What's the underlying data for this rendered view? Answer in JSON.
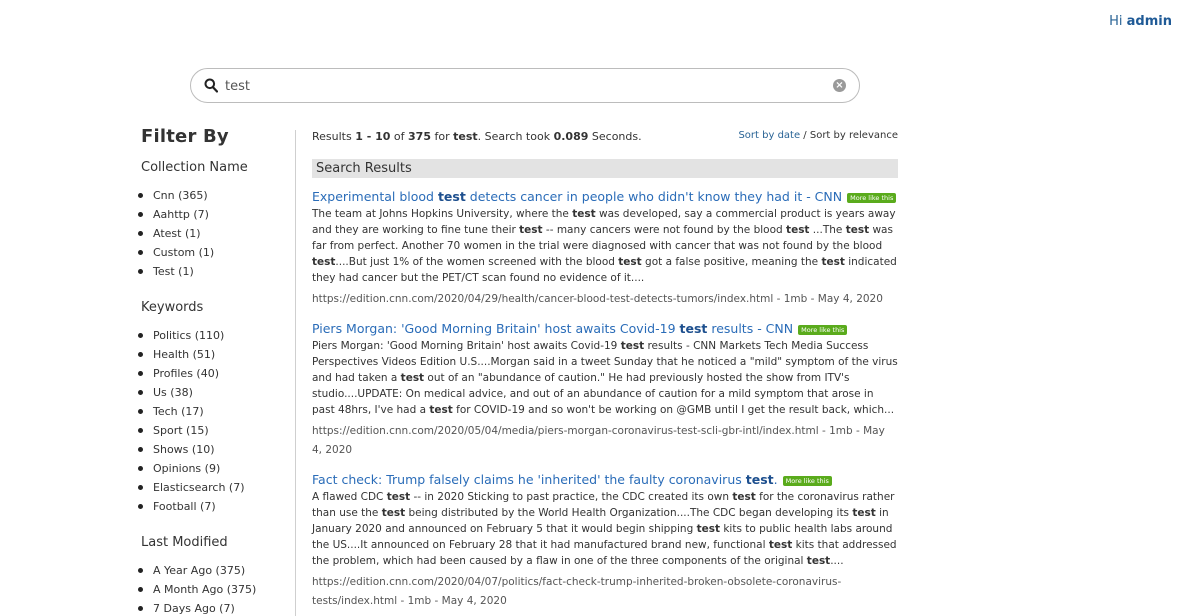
{
  "header": {
    "greeting_prefix": "Hi",
    "user": "admin"
  },
  "search": {
    "query": "test",
    "placeholder": ""
  },
  "sidebar": {
    "title": "Filter By",
    "facets": [
      {
        "title": "Collection Name",
        "items": [
          "Cnn (365)",
          "Aahttp (7)",
          "Atest (1)",
          "Custom (1)",
          "Test (1)"
        ]
      },
      {
        "title": "Keywords",
        "items": [
          "Politics (110)",
          "Health (51)",
          "Profiles (40)",
          "Us (38)",
          "Tech (17)",
          "Sport (15)",
          "Shows (10)",
          "Opinions (9)",
          "Elasticsearch (7)",
          "Football (7)"
        ]
      },
      {
        "title": "Last Modified",
        "items": [
          "A Year Ago (375)",
          "A Month Ago (375)",
          "7 Days Ago (7)"
        ]
      }
    ]
  },
  "results_meta": {
    "prefix": "Results",
    "range": "1 - 10",
    "of": "of",
    "total": "375",
    "for": "for",
    "term": "test",
    "took": ". Search took",
    "seconds_value": "0.089",
    "seconds_label": "Seconds."
  },
  "sort": {
    "by_date": "Sort by date",
    "separator": " / ",
    "by_relevance": "Sort by relevance"
  },
  "section_title": "Search Results",
  "more_like_this": "More like this",
  "results": [
    {
      "title": [
        [
          "Experimental blood ",
          false
        ],
        [
          "test",
          true
        ],
        [
          " detects cancer in people who didn't know they had it - CNN",
          false
        ]
      ],
      "snippet": [
        [
          "The team at Johns Hopkins University, where the ",
          false
        ],
        [
          "test",
          true
        ],
        [
          " was developed, say a commercial product is years away and they are working to fine tune their ",
          false
        ],
        [
          "test",
          true
        ],
        [
          " -- many cancers were not found by the blood ",
          false
        ],
        [
          "test",
          true
        ],
        [
          " ...The ",
          false
        ],
        [
          "test",
          true
        ],
        [
          " was far from perfect. Another 70 women in the trial were diagnosed with cancer that was not found by the blood ",
          false
        ],
        [
          "test",
          true
        ],
        [
          "....But just 1% of the women screened with the blood ",
          false
        ],
        [
          "test",
          true
        ],
        [
          " got a false positive, meaning the ",
          false
        ],
        [
          "test",
          true
        ],
        [
          " indicated they had cancer but the PET/CT scan found no evidence of it....",
          false
        ]
      ],
      "url": "https://edition.cnn.com/2020/04/29/health/cancer-blood-test-detects-tumors/index.html - 1mb - May 4, 2020"
    },
    {
      "title": [
        [
          "Piers Morgan: 'Good Morning Britain' host awaits Covid-19 ",
          false
        ],
        [
          "test",
          true
        ],
        [
          " results - CNN",
          false
        ]
      ],
      "snippet": [
        [
          "Piers Morgan: 'Good Morning Britain' host awaits Covid-19 ",
          false
        ],
        [
          "test",
          true
        ],
        [
          " results - CNN Markets Tech Media Success Perspectives Videos Edition U.S....Morgan said in a tweet Sunday that he noticed a \"mild\" symptom of the virus and had taken a ",
          false
        ],
        [
          "test",
          true
        ],
        [
          " out of an \"abundance of caution.\" He had previously hosted the show from ITV's studio....UPDATE: On medical advice, and out of an abundance of caution for a mild symptom that arose in past 48hrs, I've had a ",
          false
        ],
        [
          "test",
          true
        ],
        [
          " for COVID-19 and so won't be working on @GMB until I get the result back, which...",
          false
        ]
      ],
      "url": "https://edition.cnn.com/2020/05/04/media/piers-morgan-coronavirus-test-scli-gbr-intl/index.html - 1mb - May 4, 2020"
    },
    {
      "title": [
        [
          "Fact check: Trump falsely claims he 'inherited' the faulty coronavirus ",
          false
        ],
        [
          "test",
          true
        ],
        [
          ".",
          false
        ]
      ],
      "snippet": [
        [
          "A flawed CDC ",
          false
        ],
        [
          "test",
          true
        ],
        [
          " -- in 2020 Sticking to past practice, the CDC created its own ",
          false
        ],
        [
          "test",
          true
        ],
        [
          " for the coronavirus rather than use the ",
          false
        ],
        [
          "test",
          true
        ],
        [
          " being distributed by the World Health Organization....The CDC began developing its ",
          false
        ],
        [
          "test",
          true
        ],
        [
          " in January 2020 and announced on February 5 that it would begin shipping ",
          false
        ],
        [
          "test",
          true
        ],
        [
          " kits to public health labs around the US....It announced on February 28 that it had manufactured brand new, functional ",
          false
        ],
        [
          "test",
          true
        ],
        [
          " kits that addressed the problem, which had been caused by a flaw in one of the three components of the original ",
          false
        ],
        [
          "test",
          true
        ],
        [
          "....",
          false
        ]
      ],
      "url": "https://edition.cnn.com/2020/04/07/politics/fact-check-trump-inherited-broken-obsolete-coronavirus-tests/index.html - 1mb - May 4, 2020"
    }
  ]
}
